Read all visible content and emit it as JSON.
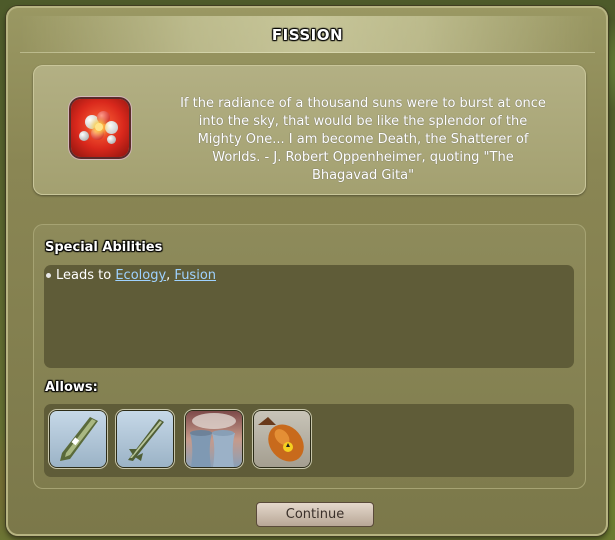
{
  "dialog": {
    "title": "FISSION",
    "tech_icon": "fission-atom-icon",
    "quote": "If the radiance of a thousand suns were to burst at once into the sky, that would be like the splendor of the Mighty One... I am become Death, the Shatterer of Worlds. - J. Robert Oppenheimer, quoting \"The Bhagavad Gita\""
  },
  "abilities": {
    "label": "Special Abilities",
    "leads_to_prefix": "Leads to",
    "separator": ", ",
    "links": [
      "Ecology",
      "Fusion"
    ]
  },
  "allows": {
    "label": "Allows:",
    "items": [
      {
        "icon": "nuclear-missile-icon"
      },
      {
        "icon": "cruise-missile-icon"
      },
      {
        "icon": "nuclear-plant-icon"
      },
      {
        "icon": "atomic-bomb-icon"
      }
    ]
  },
  "buttons": {
    "continue_label": "Continue"
  },
  "colors": {
    "panel": "#8a8654",
    "link": "#9fd2ff",
    "inner_box": "#5f5c38"
  }
}
